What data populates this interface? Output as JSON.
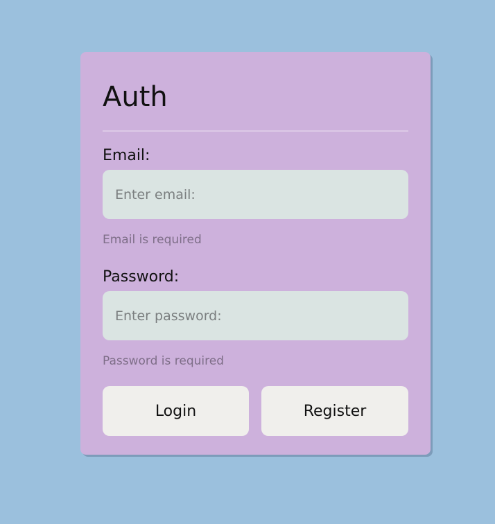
{
  "auth": {
    "title": "Auth",
    "email": {
      "label": "Email:",
      "placeholder": "Enter email:",
      "value": "",
      "error": "Email is required"
    },
    "password": {
      "label": "Password:",
      "placeholder": "Enter password:",
      "value": "",
      "error": "Password is required"
    },
    "buttons": {
      "login": "Login",
      "register": "Register"
    }
  },
  "colors": {
    "page_background": "#9bc0dd",
    "card_background": "#cdb1dc",
    "input_background": "#dae4e2",
    "button_background": "#f0efec"
  }
}
